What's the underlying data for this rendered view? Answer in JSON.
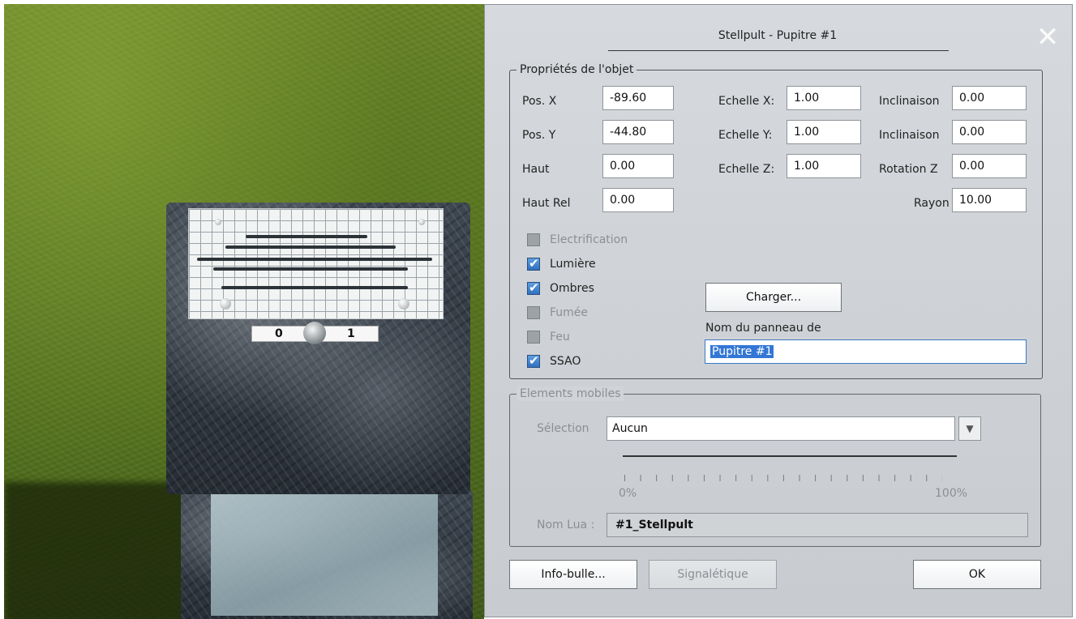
{
  "dialog": {
    "title": "Stellpult - Pupitre #1",
    "close_icon": "close-icon"
  },
  "scene": {
    "switch_left": "0",
    "switch_right": "1"
  },
  "properties": {
    "legend": "Propriétés de l'objet",
    "pos_x_label": "Pos. X",
    "pos_x_value": "-89.60",
    "pos_y_label": "Pos. Y",
    "pos_y_value": "-44.80",
    "haut_label": "Haut",
    "haut_value": "0.00",
    "haut_rel_label": "Haut Rel",
    "haut_rel_value": "0.00",
    "scale_x_label": "Echelle X:",
    "scale_x_value": "1.00",
    "scale_y_label": "Echelle Y:",
    "scale_y_value": "1.00",
    "scale_z_label": "Echelle Z:",
    "scale_z_value": "1.00",
    "incl_1_label": "Inclinaison",
    "incl_1_value": "0.00",
    "incl_2_label": "Inclinaison",
    "incl_2_value": "0.00",
    "rot_z_label": "Rotation Z",
    "rot_z_value": "0.00",
    "radius_label": "Rayon",
    "radius_value": "10.00",
    "checkboxes": [
      {
        "label": "Electrification",
        "checked": false,
        "disabled": true
      },
      {
        "label": "Lumière",
        "checked": true,
        "disabled": false
      },
      {
        "label": "Ombres",
        "checked": true,
        "disabled": false
      },
      {
        "label": "Fumée",
        "checked": false,
        "disabled": true
      },
      {
        "label": "Feu",
        "checked": false,
        "disabled": true
      },
      {
        "label": "SSAO",
        "checked": true,
        "disabled": false
      }
    ],
    "load_button": "Charger...",
    "panel_name_label": "Nom du panneau de",
    "panel_name_value": "Pupitre #1"
  },
  "mobile": {
    "legend": "Elements mobiles",
    "selection_label": "Sélection",
    "selection_value": "Aucun",
    "slider_min": "0%",
    "slider_max": "100%",
    "lua_label": "Nom Lua :",
    "lua_value": "#1_Stellpult"
  },
  "footer": {
    "tooltip_button": "Info-bulle...",
    "signage_button": "Signalétique",
    "ok_button": "OK"
  },
  "colors": {
    "checkbox_checked": "#2f6fbf",
    "selection_highlight": "#3377d6"
  }
}
